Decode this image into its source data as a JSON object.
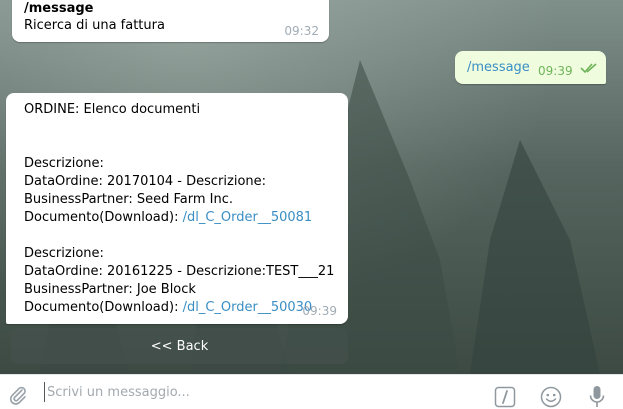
{
  "messages": [
    {
      "command": "/message",
      "text": "Ricerca di una fattura",
      "time": "09:32"
    },
    {
      "command": "/message",
      "time": "09:39"
    },
    {
      "title": "ORDINE: Elenco documenti",
      "entries": [
        {
          "descrizione": "Descrizione:",
          "data_ordine": "DataOrdine: 20170104 - Descrizione:",
          "business_partner": "BusinessPartner: Seed Farm Inc.",
          "documento_label": "Documento(Download): ",
          "documento_link": "/dl_C_Order__50081"
        },
        {
          "descrizione": "Descrizione:",
          "data_ordine": "DataOrdine: 20161225 - Descrizione:TEST___21",
          "business_partner": "BusinessPartner: Joe Block",
          "documento_label": "Documento(Download): ",
          "documento_link": "/dl_C_Order__50030"
        }
      ],
      "time": "09:39"
    }
  ],
  "keyboard": {
    "back_label": "<< Back"
  },
  "input": {
    "placeholder": "Scrivi un messaggio..."
  },
  "icons": [
    "paperclip-icon",
    "slash-commands-icon",
    "emoji-icon",
    "microphone-icon",
    "double-check-icon"
  ],
  "colors": {
    "link": "#3a8ec4",
    "outgoing_bubble": "#effdde",
    "timestamp": "#a0acb6",
    "outgoing_timestamp": "#6fb35a"
  }
}
